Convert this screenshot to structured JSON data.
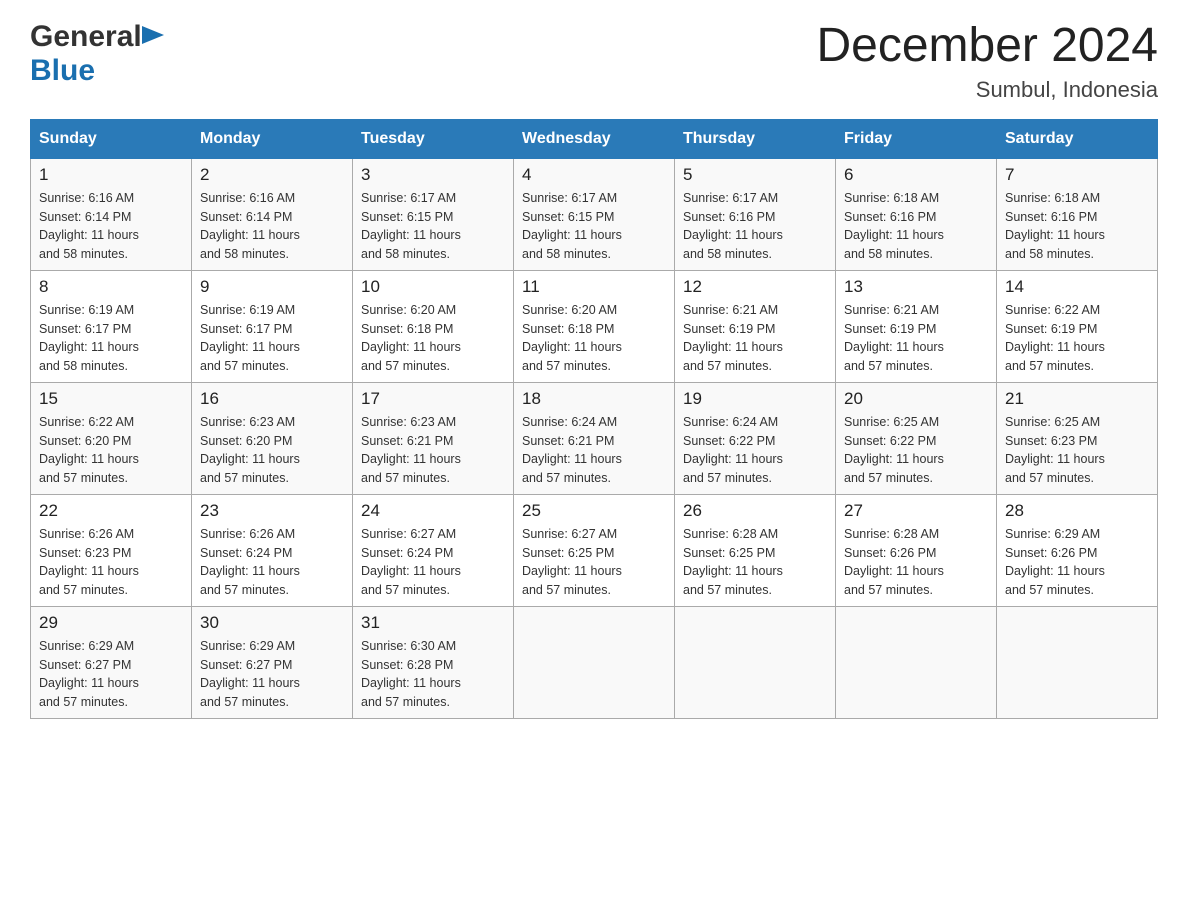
{
  "logo": {
    "general": "General",
    "blue": "Blue"
  },
  "title": "December 2024",
  "subtitle": "Sumbul, Indonesia",
  "days_of_week": [
    "Sunday",
    "Monday",
    "Tuesday",
    "Wednesday",
    "Thursday",
    "Friday",
    "Saturday"
  ],
  "weeks": [
    [
      {
        "day": "1",
        "sunrise": "6:16 AM",
        "sunset": "6:14 PM",
        "daylight": "11 hours and 58 minutes."
      },
      {
        "day": "2",
        "sunrise": "6:16 AM",
        "sunset": "6:14 PM",
        "daylight": "11 hours and 58 minutes."
      },
      {
        "day": "3",
        "sunrise": "6:17 AM",
        "sunset": "6:15 PM",
        "daylight": "11 hours and 58 minutes."
      },
      {
        "day": "4",
        "sunrise": "6:17 AM",
        "sunset": "6:15 PM",
        "daylight": "11 hours and 58 minutes."
      },
      {
        "day": "5",
        "sunrise": "6:17 AM",
        "sunset": "6:16 PM",
        "daylight": "11 hours and 58 minutes."
      },
      {
        "day": "6",
        "sunrise": "6:18 AM",
        "sunset": "6:16 PM",
        "daylight": "11 hours and 58 minutes."
      },
      {
        "day": "7",
        "sunrise": "6:18 AM",
        "sunset": "6:16 PM",
        "daylight": "11 hours and 58 minutes."
      }
    ],
    [
      {
        "day": "8",
        "sunrise": "6:19 AM",
        "sunset": "6:17 PM",
        "daylight": "11 hours and 58 minutes."
      },
      {
        "day": "9",
        "sunrise": "6:19 AM",
        "sunset": "6:17 PM",
        "daylight": "11 hours and 57 minutes."
      },
      {
        "day": "10",
        "sunrise": "6:20 AM",
        "sunset": "6:18 PM",
        "daylight": "11 hours and 57 minutes."
      },
      {
        "day": "11",
        "sunrise": "6:20 AM",
        "sunset": "6:18 PM",
        "daylight": "11 hours and 57 minutes."
      },
      {
        "day": "12",
        "sunrise": "6:21 AM",
        "sunset": "6:19 PM",
        "daylight": "11 hours and 57 minutes."
      },
      {
        "day": "13",
        "sunrise": "6:21 AM",
        "sunset": "6:19 PM",
        "daylight": "11 hours and 57 minutes."
      },
      {
        "day": "14",
        "sunrise": "6:22 AM",
        "sunset": "6:19 PM",
        "daylight": "11 hours and 57 minutes."
      }
    ],
    [
      {
        "day": "15",
        "sunrise": "6:22 AM",
        "sunset": "6:20 PM",
        "daylight": "11 hours and 57 minutes."
      },
      {
        "day": "16",
        "sunrise": "6:23 AM",
        "sunset": "6:20 PM",
        "daylight": "11 hours and 57 minutes."
      },
      {
        "day": "17",
        "sunrise": "6:23 AM",
        "sunset": "6:21 PM",
        "daylight": "11 hours and 57 minutes."
      },
      {
        "day": "18",
        "sunrise": "6:24 AM",
        "sunset": "6:21 PM",
        "daylight": "11 hours and 57 minutes."
      },
      {
        "day": "19",
        "sunrise": "6:24 AM",
        "sunset": "6:22 PM",
        "daylight": "11 hours and 57 minutes."
      },
      {
        "day": "20",
        "sunrise": "6:25 AM",
        "sunset": "6:22 PM",
        "daylight": "11 hours and 57 minutes."
      },
      {
        "day": "21",
        "sunrise": "6:25 AM",
        "sunset": "6:23 PM",
        "daylight": "11 hours and 57 minutes."
      }
    ],
    [
      {
        "day": "22",
        "sunrise": "6:26 AM",
        "sunset": "6:23 PM",
        "daylight": "11 hours and 57 minutes."
      },
      {
        "day": "23",
        "sunrise": "6:26 AM",
        "sunset": "6:24 PM",
        "daylight": "11 hours and 57 minutes."
      },
      {
        "day": "24",
        "sunrise": "6:27 AM",
        "sunset": "6:24 PM",
        "daylight": "11 hours and 57 minutes."
      },
      {
        "day": "25",
        "sunrise": "6:27 AM",
        "sunset": "6:25 PM",
        "daylight": "11 hours and 57 minutes."
      },
      {
        "day": "26",
        "sunrise": "6:28 AM",
        "sunset": "6:25 PM",
        "daylight": "11 hours and 57 minutes."
      },
      {
        "day": "27",
        "sunrise": "6:28 AM",
        "sunset": "6:26 PM",
        "daylight": "11 hours and 57 minutes."
      },
      {
        "day": "28",
        "sunrise": "6:29 AM",
        "sunset": "6:26 PM",
        "daylight": "11 hours and 57 minutes."
      }
    ],
    [
      {
        "day": "29",
        "sunrise": "6:29 AM",
        "sunset": "6:27 PM",
        "daylight": "11 hours and 57 minutes."
      },
      {
        "day": "30",
        "sunrise": "6:29 AM",
        "sunset": "6:27 PM",
        "daylight": "11 hours and 57 minutes."
      },
      {
        "day": "31",
        "sunrise": "6:30 AM",
        "sunset": "6:28 PM",
        "daylight": "11 hours and 57 minutes."
      },
      null,
      null,
      null,
      null
    ]
  ],
  "labels": {
    "sunrise": "Sunrise:",
    "sunset": "Sunset:",
    "daylight": "Daylight:"
  }
}
